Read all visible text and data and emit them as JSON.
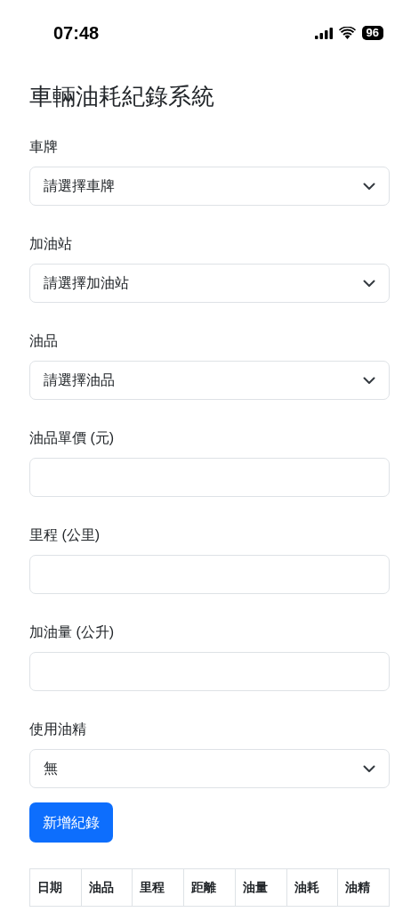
{
  "status_bar": {
    "time": "07:48",
    "battery": "96"
  },
  "title": "車輛油耗紀錄系統",
  "fields": [
    {
      "kind": "select",
      "label": "車牌",
      "value": "請選擇車牌"
    },
    {
      "kind": "select",
      "label": "加油站",
      "value": "請選擇加油站"
    },
    {
      "kind": "select",
      "label": "油品",
      "value": "請選擇油品"
    },
    {
      "kind": "input",
      "label": "油品單價 (元)"
    },
    {
      "kind": "input",
      "label": "里程 (公里)"
    },
    {
      "kind": "input",
      "label": "加油量 (公升)"
    },
    {
      "kind": "select",
      "label": "使用油精",
      "value": "無"
    }
  ],
  "submit_button": "新增紀錄",
  "table": {
    "columns": [
      "日期",
      "油品",
      "里程",
      "距離",
      "油量",
      "油耗",
      "油精"
    ]
  }
}
